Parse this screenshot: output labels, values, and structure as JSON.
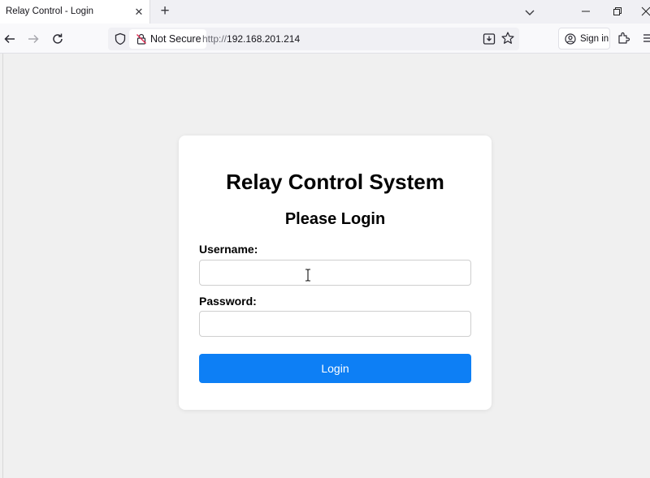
{
  "browser": {
    "tab": {
      "title": "Relay Control - Login"
    },
    "address_bar": {
      "security_label": "Not Secure",
      "url_scheme": "http://",
      "url_host": "192.168.201.214"
    },
    "sign_in_label": "Sign in"
  },
  "page": {
    "title": "Relay Control System",
    "subtitle": "Please Login",
    "username_label": "Username:",
    "password_label": "Password:",
    "username_value": "",
    "password_value": "",
    "login_button": "Login"
  },
  "colors": {
    "login_button": "#0d7ff5",
    "page_background": "#f0f0f0",
    "card_background": "#ffffff"
  }
}
